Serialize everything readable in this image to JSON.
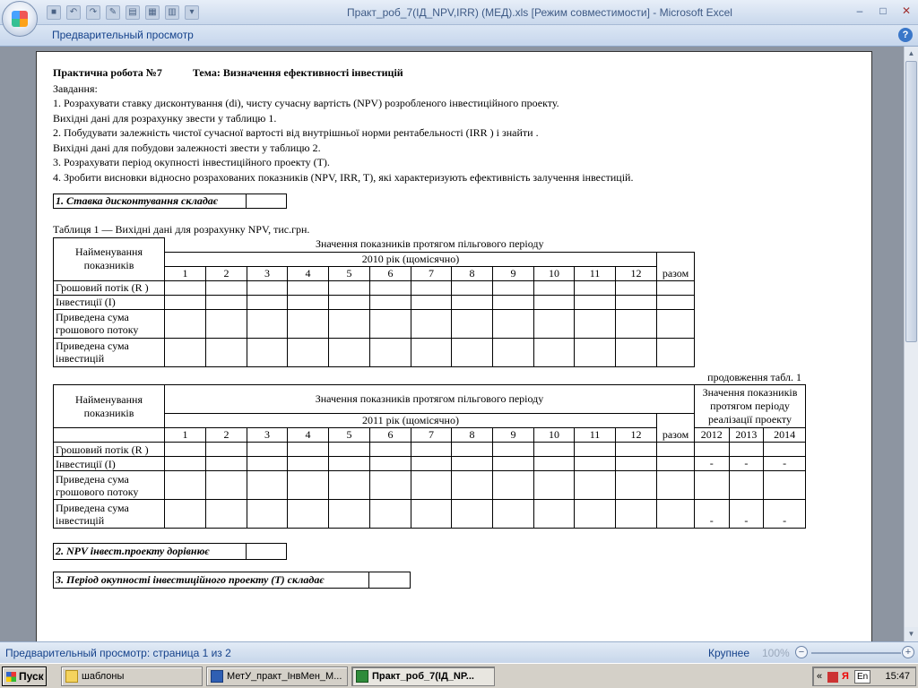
{
  "app": {
    "window_title": "Практ_роб_7(ІД_NPV,IRR) (МЕД).xls  [Режим совместимости] - Microsoft Excel",
    "ribbon_tab": "Предварительный просмотр",
    "help": "?"
  },
  "qat": {
    "undo_glyph": "↶",
    "redo_glyph": "↷",
    "dropdown_glyph": "▾"
  },
  "window_controls": {
    "minimize": "–",
    "restore": "□",
    "close": "✕"
  },
  "doc": {
    "heading_left": "Практична робота №7",
    "heading_right": "Тема:  Визначення ефективності інвестицій",
    "lines": [
      "Завдання:",
      "1. Розрахувати ставку дисконтування (di), чисту сучасну вартість (NPV) розробленого інвестиційного проекту.",
      "Вихідні дані для розрахунку звести у таблицю 1.",
      "2. Побудувати залежність чистої сучасної вартості від внутрішньої норми рентабельності  (IRR ) і знайти .",
      "Вихідні дані для побудови залежності звести у таблицю 2.",
      "3. Розрахувати період окупності інвестиційного проекту (Т).",
      "4. Зробити висновки відносно розрахованих показників (NPV, IRR, T), які характеризують ефективність залучення інвестицій."
    ],
    "box1": "1. Ставка дисконтування складає",
    "table1_caption": "Таблиця 1 — Вихідні дані для розрахунку NPV,  тис.грн.",
    "t1": {
      "name_header": "Найменування показників",
      "group_header": "Значення показників протягом пільгового періоду",
      "year_header": "2010 рік (щомісячно)",
      "months": [
        "1",
        "2",
        "3",
        "4",
        "5",
        "6",
        "7",
        "8",
        "9",
        "10",
        "11",
        "12"
      ],
      "total": "разом",
      "rows": [
        "Грошовий потік (R )",
        "Інвестиції (І)",
        "Приведена сума грошового потоку",
        "Приведена сума інвестицій"
      ]
    },
    "continuation": "продовження табл. 1",
    "t2": {
      "name_header": "Найменування показників",
      "group_header": "Значення показників протягом пільгового періоду",
      "year_header": "2011 рік (щомісячно)",
      "impl_header": "Значення показників протягом періоду реалізації проекту",
      "months": [
        "1",
        "2",
        "3",
        "4",
        "5",
        "6",
        "7",
        "8",
        "9",
        "10",
        "11",
        "12"
      ],
      "total": "разом",
      "years": [
        "2012",
        "2013",
        "2014"
      ],
      "rows": [
        "Грошовий потік (R )",
        "Інвестиції (І)",
        "Приведена сума грошового потоку",
        "Приведена сума інвестицій"
      ],
      "dash": "-"
    },
    "box2": "2. NPV інвест.проекту дорівнює",
    "box3": "3. Період окупності інвестиційного проекту (Т) складає"
  },
  "status": {
    "text": "Предварительный просмотр: страница 1 из 2",
    "zoom_label": "Крупнее",
    "zoom_value": "100%",
    "minus": "−",
    "plus": "+"
  },
  "taskbar": {
    "start": "Пуск",
    "items": [
      "шаблоны",
      "МетУ_практ_ІнвМен_М...",
      "Практ_роб_7(ІД_NP..."
    ],
    "lang": "En",
    "clock": "15:47"
  }
}
